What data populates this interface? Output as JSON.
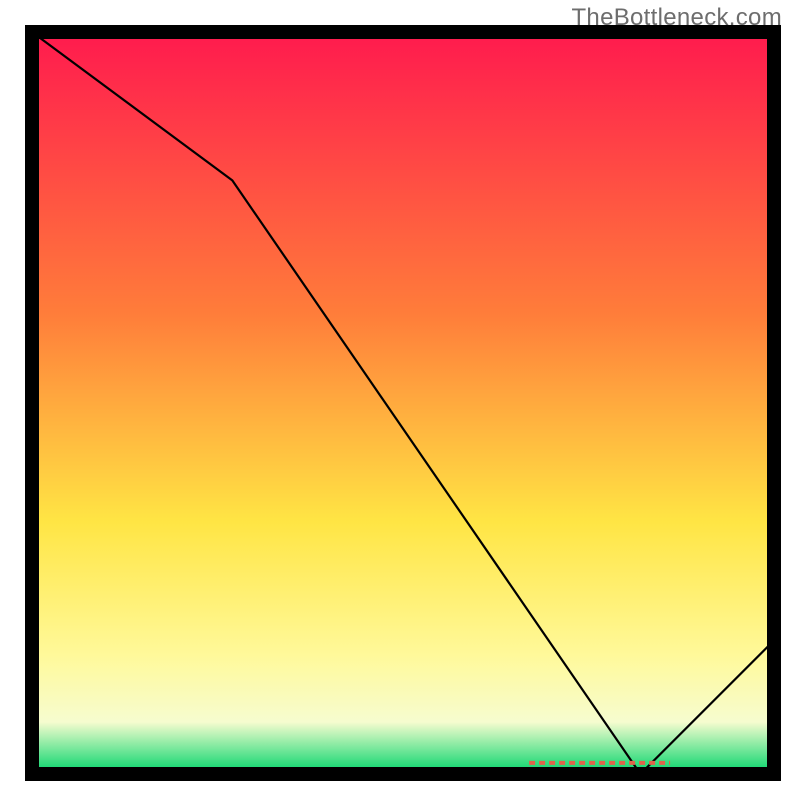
{
  "watermark": "TheBottleneck.com",
  "zone_label": "",
  "colors": {
    "grad_top": "#ff1a4e",
    "grad_mid_upper": "#ff7d3a",
    "grad_mid": "#ffe544",
    "grad_lower_yellow": "#fff99a",
    "grad_pale": "#f6fccf",
    "grad_green": "#00d46a",
    "line": "#000000",
    "frame": "#000000",
    "zone_text": "#e0644b"
  },
  "chart_data": {
    "type": "line",
    "title": "",
    "xlabel": "",
    "ylabel": "",
    "xlim": [
      0,
      100
    ],
    "ylim": [
      0,
      100
    ],
    "x": [
      0,
      27,
      82,
      100
    ],
    "values": [
      100,
      80,
      0,
      18
    ],
    "bottom_zone": {
      "x_start": 67,
      "x_end": 86,
      "y": 1.5
    }
  }
}
